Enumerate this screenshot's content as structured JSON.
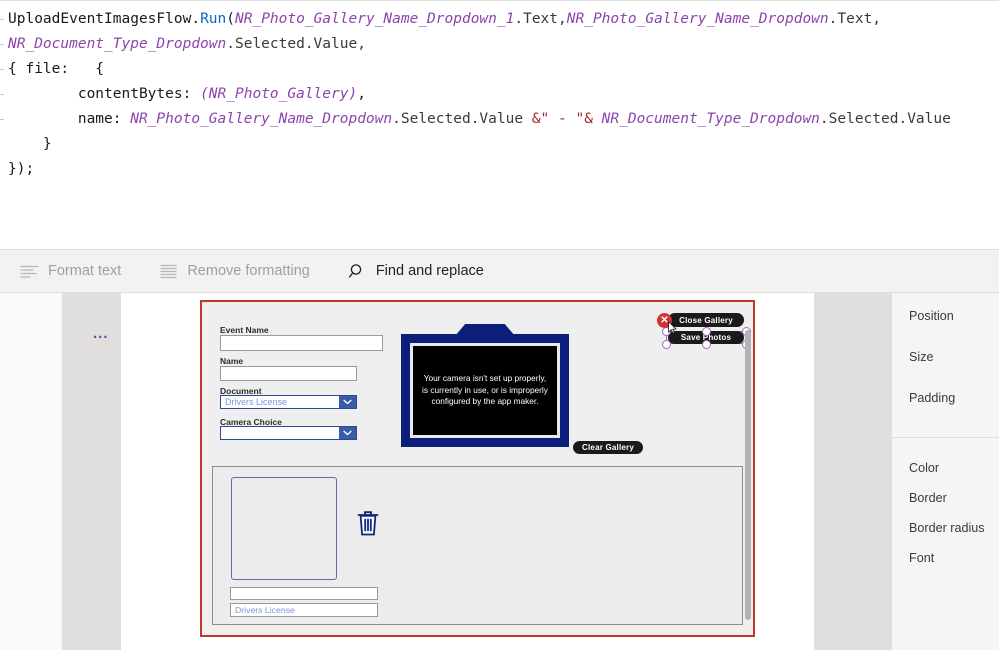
{
  "formula": {
    "lines": [
      [
        {
          "t": "UploadEventImagesFlow",
          "c": "plain"
        },
        {
          "t": ".",
          "c": "punct"
        },
        {
          "t": "Run",
          "c": "fn"
        },
        {
          "t": "(",
          "c": "punct"
        },
        {
          "t": "NR_Photo_Gallery_Name_Dropdown_1",
          "c": "ident"
        },
        {
          "t": ".Text,",
          "c": "prop"
        },
        {
          "t": "NR_Photo_Gallery_Name_Dropdown",
          "c": "ident"
        },
        {
          "t": ".Text,",
          "c": "prop"
        }
      ],
      [
        {
          "t": "NR_Document_Type_Dropdown",
          "c": "ident"
        },
        {
          "t": ".Selected.Value,",
          "c": "prop"
        }
      ],
      [
        {
          "t": "{ file:   {",
          "c": "plain"
        }
      ],
      [
        {
          "t": "        contentBytes: ",
          "c": "plain"
        },
        {
          "t": "(NR_Photo_Gallery)",
          "c": "ident"
        },
        {
          "t": ",",
          "c": "punct"
        }
      ],
      [
        {
          "t": "        name: ",
          "c": "plain"
        },
        {
          "t": "NR_Photo_Gallery_Name_Dropdown",
          "c": "ident"
        },
        {
          "t": ".Selected.Value ",
          "c": "prop"
        },
        {
          "t": "&\" - \"&",
          "c": "str"
        },
        {
          "t": " ",
          "c": "plain"
        },
        {
          "t": "NR_Document_Type_Dropdown",
          "c": "ident"
        },
        {
          "t": ".Selected.Value",
          "c": "prop"
        }
      ],
      [
        {
          "t": "    }",
          "c": "plain"
        }
      ],
      [
        {
          "t": "});",
          "c": "plain"
        }
      ]
    ]
  },
  "toolbar": {
    "format_text": "Format text",
    "remove_formatting": "Remove formatting",
    "find_and_replace": "Find and replace"
  },
  "tree": {
    "ellipsis": "..."
  },
  "app_screen": {
    "fields": [
      {
        "label": "Event Name",
        "value": "",
        "type": "text"
      },
      {
        "label": "Name",
        "value": "",
        "type": "text"
      },
      {
        "label": "Document",
        "value": "Drivers License",
        "type": "dropdown"
      },
      {
        "label": "Camera Choice",
        "value": "",
        "type": "dropdown"
      }
    ],
    "camera_message": "Your camera isn't set up properly, is currently in use, or is improperly configured by the app maker.",
    "buttons": {
      "close_gallery": "Close Gallery",
      "save_photos": "Save Photos",
      "clear_gallery": "Clear Gallery"
    },
    "gallery": {
      "name_field_value": "",
      "type_field_value": "Drivers License"
    }
  },
  "properties_panel": {
    "group_layout": [
      "Position",
      "Size",
      "Padding"
    ],
    "group_style": [
      "Color",
      "Border",
      "Border radius",
      "Font"
    ]
  },
  "colors": {
    "selection_red": "#c0392b",
    "handle_purple": "#a36bbf",
    "camera_navy": "#0b1f7a",
    "dropdown_blue": "#3b5ba8",
    "close_red": "#d13438",
    "fn_blue": "#0b67c2",
    "ident_purple": "#8e44ad",
    "string_maroon": "#a4262c"
  }
}
